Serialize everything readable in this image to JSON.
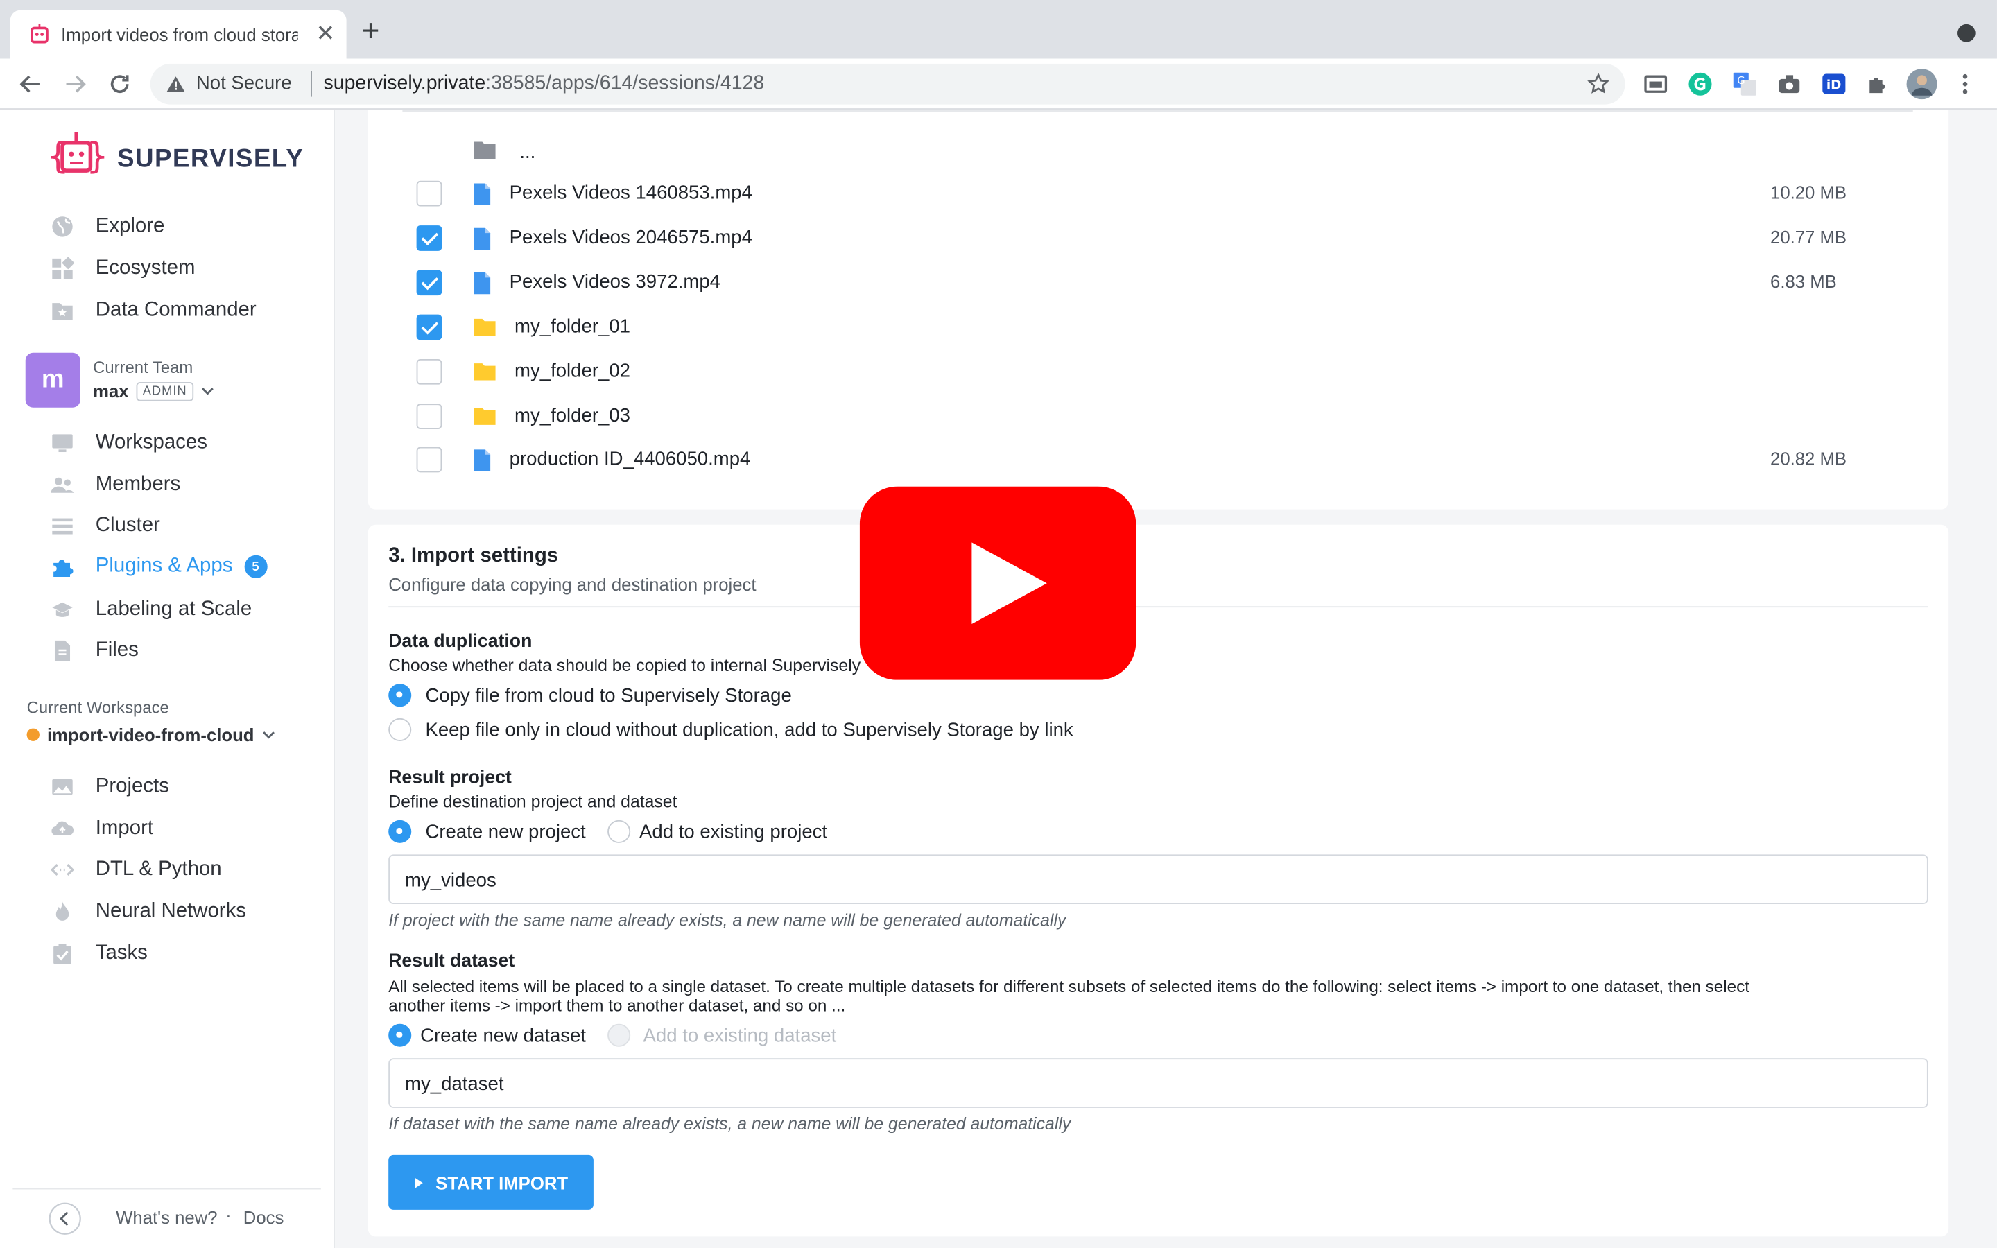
{
  "browser": {
    "tab_title": "Import videos from cloud storage",
    "tab_close": "✕",
    "new_tab": "+",
    "security_label": "Not Secure",
    "url_host": "supervisely.private",
    "url_path": ":38585/apps/614/sessions/4128"
  },
  "sidebar": {
    "logo_text": "SUPERVISELY",
    "top_items": [
      {
        "label": "Explore",
        "icon": "globe-icon"
      },
      {
        "label": "Ecosystem",
        "icon": "grid-icon"
      },
      {
        "label": "Data Commander",
        "icon": "folder-star-icon"
      }
    ],
    "team": {
      "caption": "Current Team",
      "avatar_letter": "m",
      "name": "max",
      "role": "ADMIN"
    },
    "team_items": [
      {
        "label": "Workspaces",
        "icon": "monitor-icon"
      },
      {
        "label": "Members",
        "icon": "people-icon"
      },
      {
        "label": "Cluster",
        "icon": "list-icon"
      },
      {
        "label": "Plugins & Apps",
        "icon": "puzzle-icon",
        "badge": "5",
        "active": true
      },
      {
        "label": "Labeling at Scale",
        "icon": "graduation-icon"
      },
      {
        "label": "Files",
        "icon": "file-icon"
      }
    ],
    "workspace": {
      "caption": "Current Workspace",
      "name": "import-video-from-cloud"
    },
    "workspace_items": [
      {
        "label": "Projects",
        "icon": "images-icon"
      },
      {
        "label": "Import",
        "icon": "cloud-upload-icon"
      },
      {
        "label": "DTL & Python",
        "icon": "code-icon"
      },
      {
        "label": "Neural Networks",
        "icon": "flame-icon"
      },
      {
        "label": "Tasks",
        "icon": "clipboard-check-icon"
      }
    ],
    "footer": {
      "whats_new": "What's new?",
      "separator": "·",
      "docs": "Docs"
    }
  },
  "files": {
    "parent": "...",
    "rows": [
      {
        "name": "Pexels Videos 1460853.mp4",
        "type": "file",
        "size": "10.20 MB",
        "checked": false
      },
      {
        "name": "Pexels Videos 2046575.mp4",
        "type": "file",
        "size": "20.77 MB",
        "checked": true
      },
      {
        "name": "Pexels Videos 3972.mp4",
        "type": "file",
        "size": "6.83 MB",
        "checked": true
      },
      {
        "name": "my_folder_01",
        "type": "folder",
        "size": "",
        "checked": true
      },
      {
        "name": "my_folder_02",
        "type": "folder",
        "size": "",
        "checked": false
      },
      {
        "name": "my_folder_03",
        "type": "folder",
        "size": "",
        "checked": false
      },
      {
        "name": "production ID_4406050.mp4",
        "type": "file",
        "size": "20.82 MB",
        "checked": false
      }
    ]
  },
  "settings": {
    "title": "3. Import settings",
    "subtitle": "Configure data copying and destination project",
    "duplication": {
      "heading": "Data duplication",
      "description": "Choose whether data should be copied to internal Supervisely",
      "options": [
        "Copy file from cloud to Supervisely Storage",
        "Keep file only in cloud without duplication, add to Supervisely Storage by link"
      ],
      "selected": 0
    },
    "project": {
      "heading": "Result project",
      "description": "Define destination project and dataset",
      "options": [
        "Create new project",
        "Add to existing project"
      ],
      "selected": 0,
      "value": "my_videos",
      "hint": "If project with the same name already exists, a new name will be generated automatically"
    },
    "dataset": {
      "heading": "Result dataset",
      "description_line1": "All selected items will be placed to a single dataset. To create multiple datasets for different subsets of selected items do the following: select items -> import to one dataset, then select",
      "description_line2": "another items -> import them to another dataset, and so on ...",
      "options": [
        "Create new dataset",
        "Add to existing dataset"
      ],
      "selected": 0,
      "value": "my_dataset",
      "hint": "If dataset with the same name already exists, a new name will be generated automatically"
    },
    "start_button": "START IMPORT"
  },
  "colors": {
    "accent": "#2d98f0",
    "youtube_red": "#f00",
    "avatar": "#a47ee8",
    "badge": "#2d98f0"
  }
}
